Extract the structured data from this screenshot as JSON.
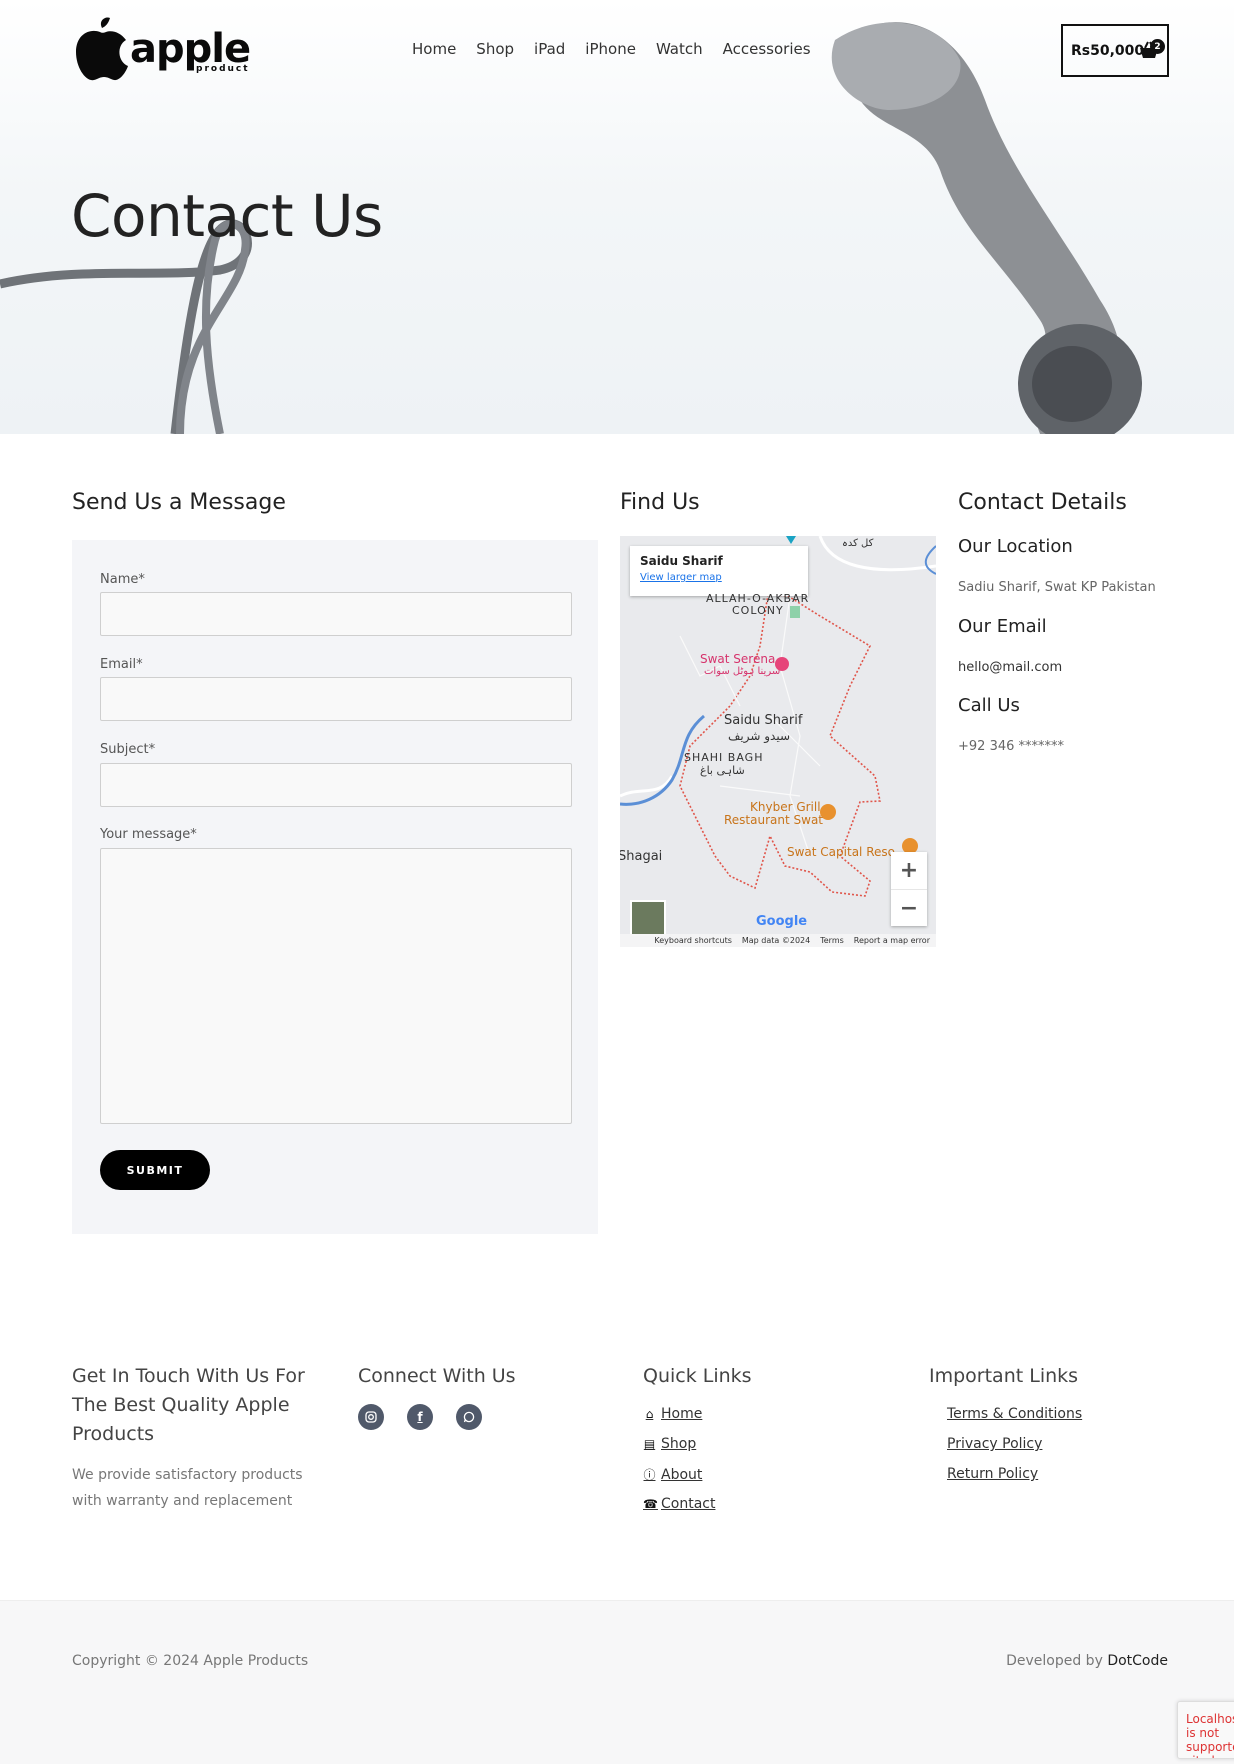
{
  "header": {
    "logo_text": "apple",
    "logo_sub": "product",
    "nav": [
      "Home",
      "Shop",
      "iPad",
      "iPhone",
      "Watch",
      "Accessories"
    ],
    "cart_total": "Rs50,000",
    "cart_count": "2"
  },
  "hero": {
    "title": "Contact Us"
  },
  "form": {
    "heading": "Send Us a Message",
    "name_label": "Name*",
    "email_label": "Email*",
    "subject_label": "Subject*",
    "message_label": "Your message*",
    "name_value": "",
    "email_value": "",
    "subject_value": "",
    "message_value": "",
    "submit_label": "SUBMIT"
  },
  "map": {
    "heading": "Find Us",
    "card_title": "Saidu Sharif",
    "card_link": "View larger map",
    "labels": [
      "ALLAH-O-AKBAR",
      "COLONY",
      "Swat Serena",
      "سرینا ہوٹل سوات",
      "Saidu Sharif",
      "سیدو شریف",
      "SHAHI BAGH",
      "شاہی باغ",
      "Khyber Grill",
      "Restaurant Swat",
      "Swat Capital Reso",
      "Shagai",
      "کل کدہ"
    ],
    "zoom_in": "+",
    "zoom_out": "−",
    "google": "Google",
    "footer": [
      "Keyboard shortcuts",
      "Map data ©2024",
      "Terms",
      "Report a map error"
    ]
  },
  "contact": {
    "heading": "Contact Details",
    "location_heading": "Our Location",
    "location": "Sadiu Sharif, Swat KP Pakistan",
    "email_heading": "Our Email",
    "email": "hello@mail.com",
    "call_heading": "Call Us",
    "phone": "+92 346 *******"
  },
  "footer": {
    "tagline": "Get In Touch With Us For The Best Quality Apple Products",
    "description": "We provide satisfactory products with warranty and replacement",
    "connect_heading": "Connect With Us",
    "social_icons": [
      "instagram-icon",
      "facebook-icon",
      "whatsapp-icon"
    ],
    "quick_heading": "Quick Links",
    "quick_links": [
      "Home",
      "Shop",
      "About",
      "Contact"
    ],
    "important_heading": "Important Links",
    "important_links": [
      "Terms & Conditions",
      "Privacy Policy",
      "Return Policy"
    ],
    "copyright": "Copyright © 2024 Apple Products",
    "developed_by": "Developed by",
    "developer": "DotCode",
    "recaptcha_text": "Localhost is not supported site key."
  },
  "colors": {
    "accent": "#000000",
    "form_bg": "#f4f5f8",
    "social_bg": "#50596a",
    "map_boundary": "#e0554a",
    "map_link": "#1a73e8"
  }
}
